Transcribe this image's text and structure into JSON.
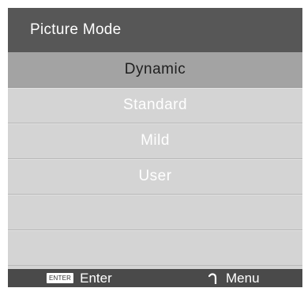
{
  "menu": {
    "title": "Picture Mode",
    "options": [
      {
        "label": "Dynamic",
        "selected": true
      },
      {
        "label": "Standard",
        "selected": false
      },
      {
        "label": "Mild",
        "selected": false
      },
      {
        "label": "User",
        "selected": false
      },
      {
        "label": "",
        "selected": false
      },
      {
        "label": "",
        "selected": false
      }
    ]
  },
  "footer": {
    "enter_badge": "ENTER",
    "enter_label": "Enter",
    "menu_icon": "return-arrow-icon",
    "menu_label": "Menu"
  },
  "colors": {
    "header_bg": "#575757",
    "panel_bg": "#d4d4d4",
    "selected_bg": "#a3a3a3",
    "footer_bg": "#4a4a4a",
    "text_light": "#ffffff",
    "text_dark": "#1f1f1f"
  }
}
